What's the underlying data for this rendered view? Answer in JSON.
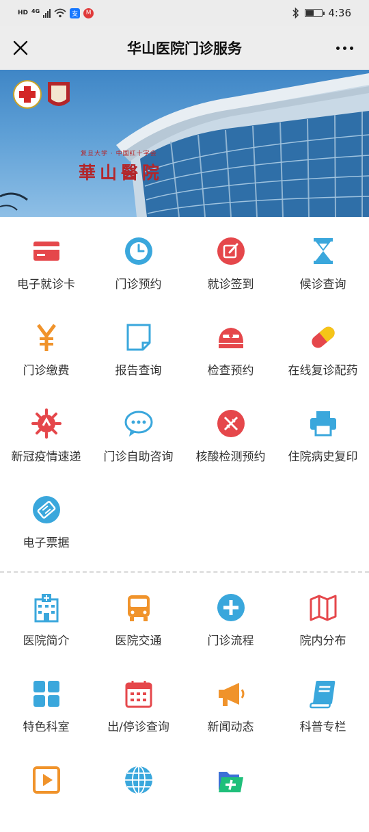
{
  "status_bar": {
    "network_hd": "HD",
    "network_4g": "4G",
    "time": "4:36"
  },
  "title_bar": {
    "title": "华山医院门诊服务",
    "close_icon": "close-icon",
    "more_icon": "more-icon"
  },
  "banner": {
    "logo_subtitle": "复旦大学 · 中国红十字会",
    "logo_name": "華山醫院"
  },
  "section1": [
    {
      "label": "电子就诊卡",
      "icon": "card-icon",
      "color": "#e5474b"
    },
    {
      "label": "门诊预约",
      "icon": "clock-icon",
      "color": "#3aa7dc"
    },
    {
      "label": "就诊签到",
      "icon": "edit-icon",
      "color": "#e5474b"
    },
    {
      "label": "候诊查询",
      "icon": "hourglass-icon",
      "color": "#3aa7dc"
    },
    {
      "label": "门诊缴费",
      "icon": "yen-icon",
      "color": "#f0932b"
    },
    {
      "label": "报告查询",
      "icon": "note-icon",
      "color": "#3aa7dc"
    },
    {
      "label": "检查预约",
      "icon": "scanner-icon",
      "color": "#e5474b"
    },
    {
      "label": "在线复诊配药",
      "icon": "pill-icon",
      "color": "#f5c518"
    },
    {
      "label": "新冠疫情速递",
      "icon": "virus-icon",
      "color": "#e5474b"
    },
    {
      "label": "门诊自助咨询",
      "icon": "chat-icon",
      "color": "#3aa7dc"
    },
    {
      "label": "核酸检测预约",
      "icon": "dna-icon",
      "color": "#e5474b"
    },
    {
      "label": "住院病史复印",
      "icon": "printer-icon",
      "color": "#3aa7dc"
    },
    {
      "label": "电子票据",
      "icon": "ticket-icon",
      "color": "#3aa7dc"
    }
  ],
  "section2": [
    {
      "label": "医院简介",
      "icon": "hospital-icon",
      "color": "#3aa7dc"
    },
    {
      "label": "医院交通",
      "icon": "bus-icon",
      "color": "#f0932b"
    },
    {
      "label": "门诊流程",
      "icon": "plus-circle-icon",
      "color": "#3aa7dc"
    },
    {
      "label": "院内分布",
      "icon": "map-icon",
      "color": "#e5474b"
    },
    {
      "label": "特色科室",
      "icon": "grid-icon",
      "color": "#3aa7dc"
    },
    {
      "label": "出/停诊查询",
      "icon": "calendar-icon",
      "color": "#e5474b"
    },
    {
      "label": "新闻动态",
      "icon": "megaphone-icon",
      "color": "#f0932b"
    },
    {
      "label": "科普专栏",
      "icon": "book-icon",
      "color": "#3aa7dc"
    },
    {
      "label": "",
      "icon": "play-icon",
      "color": "#f0932b"
    },
    {
      "label": "",
      "icon": "globe-icon",
      "color": "#3aa7dc"
    },
    {
      "label": "",
      "icon": "folder-plus-icon",
      "color": "#1fbf7a"
    }
  ]
}
